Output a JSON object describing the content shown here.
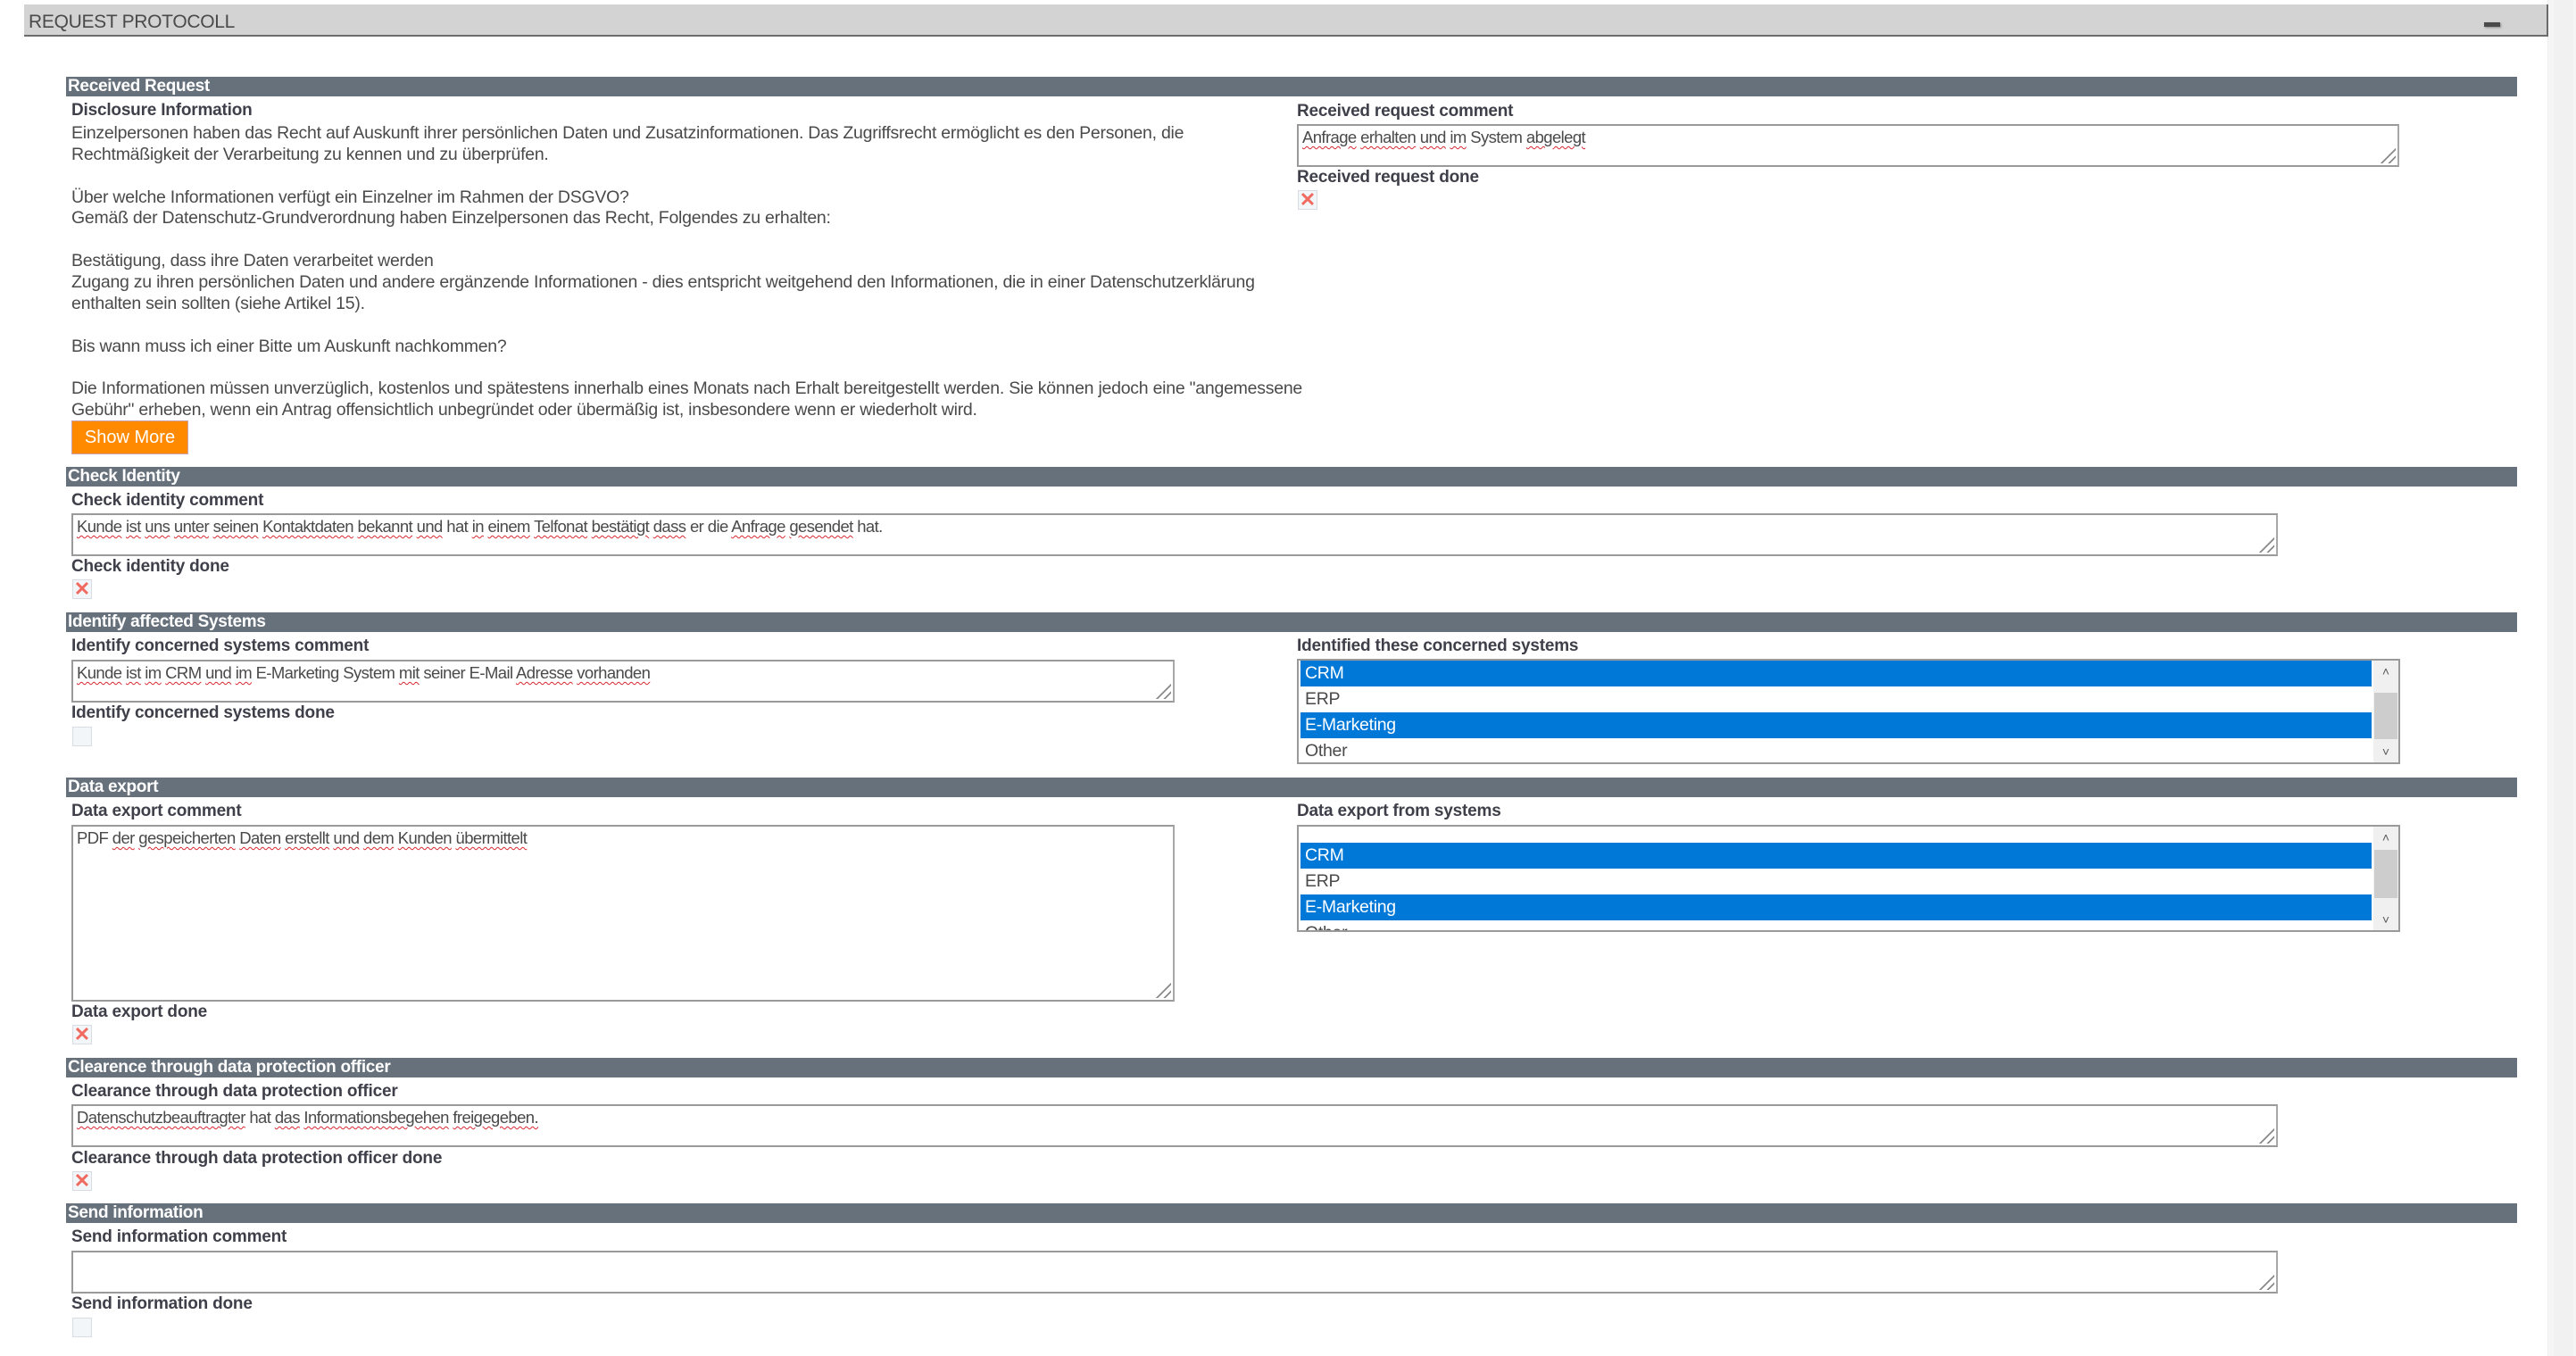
{
  "panel": {
    "title": "REQUEST PROTOCOLL",
    "collapse_icon": "minus-icon"
  },
  "received_request": {
    "header": "Received Request",
    "disclosure_label": "Disclosure Information",
    "disclosure_paragraphs": [
      "Einzelpersonen haben das Recht auf Auskunft ihrer persönlichen Daten und Zusatzinformationen. Das Zugriffsrecht ermöglicht es den Personen, die Rechtmäßigkeit der Verarbeitung zu kennen und zu überprüfen.",
      "",
      "Über welche Informationen verfügt ein Einzelner im Rahmen der DSGVO?",
      "Gemäß der Datenschutz-Grundverordnung haben Einzelpersonen das Recht, Folgendes zu erhalten:",
      "",
      "Bestätigung, dass ihre Daten verarbeitet werden",
      "Zugang zu ihren persönlichen Daten und andere ergänzende Informationen - dies entspricht weitgehend den Informationen, die in einer Datenschutzerklärung enthalten sein sollten (siehe Artikel 15).",
      "",
      "Bis wann muss ich einer Bitte um Auskunft nachkommen?",
      "",
      "Die Informationen müssen unverzüglich, kostenlos und spätestens innerhalb eines Monats nach Erhalt bereitgestellt werden. Sie können jedoch eine \"angemessene Gebühr\" erheben, wenn ein Antrag offensichtlich unbegründet oder übermäßig ist, insbesondere wenn er wiederholt wird."
    ],
    "show_more_label": "Show More",
    "comment_label": "Received request comment",
    "comment_value": "Anfrage erhalten und im System abgelegt",
    "done_label": "Received request done",
    "done": false
  },
  "check_identity": {
    "header": "Check Identity",
    "comment_label": "Check identity comment",
    "comment_value": "Kunde ist uns unter seinen Kontaktdaten bekannt und hat in einem Telfonat bestätigt dass er die Anfrage gesendet hat.",
    "done_label": "Check identity done",
    "done": false
  },
  "identify_systems": {
    "header": "Identify affected Systems",
    "comment_label": "Identify concerned systems comment",
    "comment_value": "Kunde ist im CRM und im E-Marketing System mit seiner E-Mail Adresse vorhanden",
    "done_label": "Identify concerned systems done",
    "done": null,
    "systems_label": "Identified these concerned systems",
    "systems_options": [
      {
        "label": "CRM",
        "selected": true
      },
      {
        "label": "ERP",
        "selected": false
      },
      {
        "label": "E-Marketing",
        "selected": true
      },
      {
        "label": "Other",
        "selected": false
      }
    ]
  },
  "data_export": {
    "header": "Data export",
    "comment_label": "Data export comment",
    "comment_value": "PDF der gespeicherten Daten erstellt und dem Kunden übermittelt",
    "done_label": "Data export done",
    "done": false,
    "systems_label": "Data export from systems",
    "systems_options": [
      {
        "label": "",
        "selected": false
      },
      {
        "label": "CRM",
        "selected": true
      },
      {
        "label": "ERP",
        "selected": false
      },
      {
        "label": "E-Marketing",
        "selected": true
      },
      {
        "label": "Other",
        "selected": false
      }
    ]
  },
  "clearance": {
    "header": "Clearence through data protection officer",
    "comment_label": "Clearance through data protection officer",
    "comment_value": "Datenschutzbeauftragter hat das Informationsbegehen freigegeben.",
    "done_label": "Clearance through data protection officer done",
    "done": false
  },
  "send_information": {
    "header": "Send information",
    "comment_label": "Send information comment",
    "comment_value": "",
    "done_label": "Send information done",
    "done": null
  },
  "icons": {
    "x_mark": "✕",
    "scroll_up": "˄",
    "scroll_down": "˅"
  },
  "colors": {
    "section_header_bg": "#67717c",
    "show_more_bg": "#ff8a00",
    "selected_option_bg": "#0078d7",
    "x_mark": "#f06a60"
  }
}
